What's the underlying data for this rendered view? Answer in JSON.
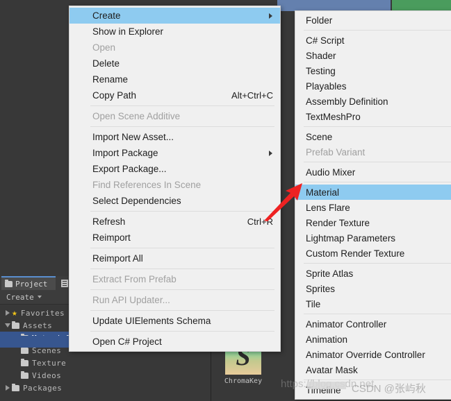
{
  "app": {
    "background_color": "#383838",
    "menu_bg": "#f0f0f0",
    "highlight_color": "#8ecbf0",
    "selection_color": "#37568f",
    "accent_red": "#ee2222"
  },
  "top_bands": {
    "blue_label": "scene-view-band",
    "green_label": "game-view-band",
    "blue_color": "#6480ae",
    "green_color": "#4a9c5d"
  },
  "project_panel": {
    "tab_label": "Project",
    "secondary_tab_label": "",
    "create_button_label": "Create",
    "tree": [
      {
        "label": "Favorites",
        "indent": 0,
        "twisty": "right",
        "icon": "star-icon",
        "selected": false
      },
      {
        "label": "Assets",
        "indent": 0,
        "twisty": "down",
        "icon": "folder-icon",
        "selected": false
      },
      {
        "label": "Material",
        "indent": 2,
        "twisty": "none",
        "icon": "folder-icon",
        "selected": true
      },
      {
        "label": "Scenes",
        "indent": 2,
        "twisty": "none",
        "icon": "folder-icon",
        "selected": false
      },
      {
        "label": "Texture",
        "indent": 2,
        "twisty": "none",
        "icon": "folder-icon",
        "selected": false
      },
      {
        "label": "Videos",
        "indent": 2,
        "twisty": "none",
        "icon": "folder-icon",
        "selected": false
      },
      {
        "label": "Packages",
        "indent": 0,
        "twisty": "right",
        "icon": "folder-icon",
        "selected": false
      }
    ]
  },
  "assets_pane": {
    "item_label": "ChromaKey",
    "item_glyph": "S"
  },
  "context_menu": {
    "items": [
      {
        "label": "Create",
        "shortcut": "",
        "disabled": false,
        "submenu": true,
        "highlighted": true
      },
      {
        "label": "Show in Explorer",
        "shortcut": "",
        "disabled": false,
        "submenu": false,
        "highlighted": false
      },
      {
        "label": "Open",
        "shortcut": "",
        "disabled": true,
        "submenu": false,
        "highlighted": false
      },
      {
        "label": "Delete",
        "shortcut": "",
        "disabled": false,
        "submenu": false,
        "highlighted": false
      },
      {
        "label": "Rename",
        "shortcut": "",
        "disabled": false,
        "submenu": false,
        "highlighted": false
      },
      {
        "label": "Copy Path",
        "shortcut": "Alt+Ctrl+C",
        "disabled": false,
        "submenu": false,
        "highlighted": false
      },
      {
        "separator": true
      },
      {
        "label": "Open Scene Additive",
        "shortcut": "",
        "disabled": true,
        "submenu": false,
        "highlighted": false
      },
      {
        "separator": true
      },
      {
        "label": "Import New Asset...",
        "shortcut": "",
        "disabled": false,
        "submenu": false,
        "highlighted": false
      },
      {
        "label": "Import Package",
        "shortcut": "",
        "disabled": false,
        "submenu": true,
        "highlighted": false
      },
      {
        "label": "Export Package...",
        "shortcut": "",
        "disabled": false,
        "submenu": false,
        "highlighted": false
      },
      {
        "label": "Find References In Scene",
        "shortcut": "",
        "disabled": true,
        "submenu": false,
        "highlighted": false
      },
      {
        "label": "Select Dependencies",
        "shortcut": "",
        "disabled": false,
        "submenu": false,
        "highlighted": false
      },
      {
        "separator": true
      },
      {
        "label": "Refresh",
        "shortcut": "Ctrl+R",
        "disabled": false,
        "submenu": false,
        "highlighted": false
      },
      {
        "label": "Reimport",
        "shortcut": "",
        "disabled": false,
        "submenu": false,
        "highlighted": false
      },
      {
        "separator": true
      },
      {
        "label": "Reimport All",
        "shortcut": "",
        "disabled": false,
        "submenu": false,
        "highlighted": false
      },
      {
        "separator": true
      },
      {
        "label": "Extract From Prefab",
        "shortcut": "",
        "disabled": true,
        "submenu": false,
        "highlighted": false
      },
      {
        "separator": true
      },
      {
        "label": "Run API Updater...",
        "shortcut": "",
        "disabled": true,
        "submenu": false,
        "highlighted": false
      },
      {
        "separator": true
      },
      {
        "label": "Update UIElements Schema",
        "shortcut": "",
        "disabled": false,
        "submenu": false,
        "highlighted": false
      },
      {
        "separator": true
      },
      {
        "label": "Open C# Project",
        "shortcut": "",
        "disabled": false,
        "submenu": false,
        "highlighted": false
      }
    ]
  },
  "create_submenu": {
    "items": [
      {
        "label": "Folder",
        "disabled": false,
        "submenu": false,
        "highlighted": false
      },
      {
        "separator": true
      },
      {
        "label": "C# Script",
        "disabled": false,
        "submenu": false,
        "highlighted": false
      },
      {
        "label": "Shader",
        "disabled": false,
        "submenu": true,
        "highlighted": false
      },
      {
        "label": "Testing",
        "disabled": false,
        "submenu": true,
        "highlighted": false
      },
      {
        "label": "Playables",
        "disabled": false,
        "submenu": true,
        "highlighted": false
      },
      {
        "label": "Assembly Definition",
        "disabled": false,
        "submenu": false,
        "highlighted": false
      },
      {
        "label": "TextMeshPro",
        "disabled": false,
        "submenu": true,
        "highlighted": false
      },
      {
        "separator": true
      },
      {
        "label": "Scene",
        "disabled": false,
        "submenu": false,
        "highlighted": false
      },
      {
        "label": "Prefab Variant",
        "disabled": true,
        "submenu": false,
        "highlighted": false
      },
      {
        "separator": true
      },
      {
        "label": "Audio Mixer",
        "disabled": false,
        "submenu": false,
        "highlighted": false
      },
      {
        "separator": true
      },
      {
        "label": "Material",
        "disabled": false,
        "submenu": false,
        "highlighted": true
      },
      {
        "label": "Lens Flare",
        "disabled": false,
        "submenu": false,
        "highlighted": false
      },
      {
        "label": "Render Texture",
        "disabled": false,
        "submenu": false,
        "highlighted": false
      },
      {
        "label": "Lightmap Parameters",
        "disabled": false,
        "submenu": false,
        "highlighted": false
      },
      {
        "label": "Custom Render Texture",
        "disabled": false,
        "submenu": false,
        "highlighted": false
      },
      {
        "separator": true
      },
      {
        "label": "Sprite Atlas",
        "disabled": false,
        "submenu": false,
        "highlighted": false
      },
      {
        "label": "Sprites",
        "disabled": false,
        "submenu": true,
        "highlighted": false
      },
      {
        "label": "Tile",
        "disabled": false,
        "submenu": false,
        "highlighted": false
      },
      {
        "separator": true
      },
      {
        "label": "Animator Controller",
        "disabled": false,
        "submenu": false,
        "highlighted": false
      },
      {
        "label": "Animation",
        "disabled": false,
        "submenu": false,
        "highlighted": false
      },
      {
        "label": "Animator Override Controller",
        "disabled": false,
        "submenu": false,
        "highlighted": false
      },
      {
        "label": "Avatar Mask",
        "disabled": false,
        "submenu": false,
        "highlighted": false
      },
      {
        "separator": true
      },
      {
        "label": "Timeline",
        "disabled": false,
        "submenu": false,
        "highlighted": false
      }
    ]
  },
  "annotation": {
    "arrow_name": "red-pointer-arrow",
    "arrow_color": "#ee2222",
    "points_at": "Material"
  },
  "watermark": {
    "url_text": "https://blog.csdn.net",
    "credit_text": "CSDN @张屿秋"
  }
}
